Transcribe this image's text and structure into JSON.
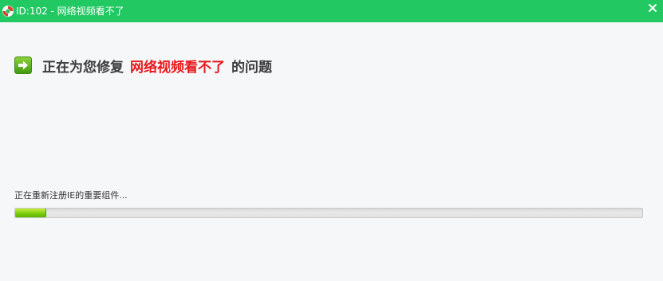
{
  "window": {
    "title": "ID:102 - 网络视频看不了",
    "accent_color": "#22c862",
    "title_icon": "lifebuoy-icon",
    "close_icon": "close-icon"
  },
  "main": {
    "heading_prefix": "正在为您修复",
    "problem_name": "网络视频看不了",
    "heading_suffix": "的问题",
    "heading_icon": "arrow-right-icon",
    "highlight_color": "#e8191b"
  },
  "progress": {
    "status_text": "正在重新注册IE的重要组件...",
    "value_fraction": 0.05,
    "fill_color": "#7ccd10"
  }
}
